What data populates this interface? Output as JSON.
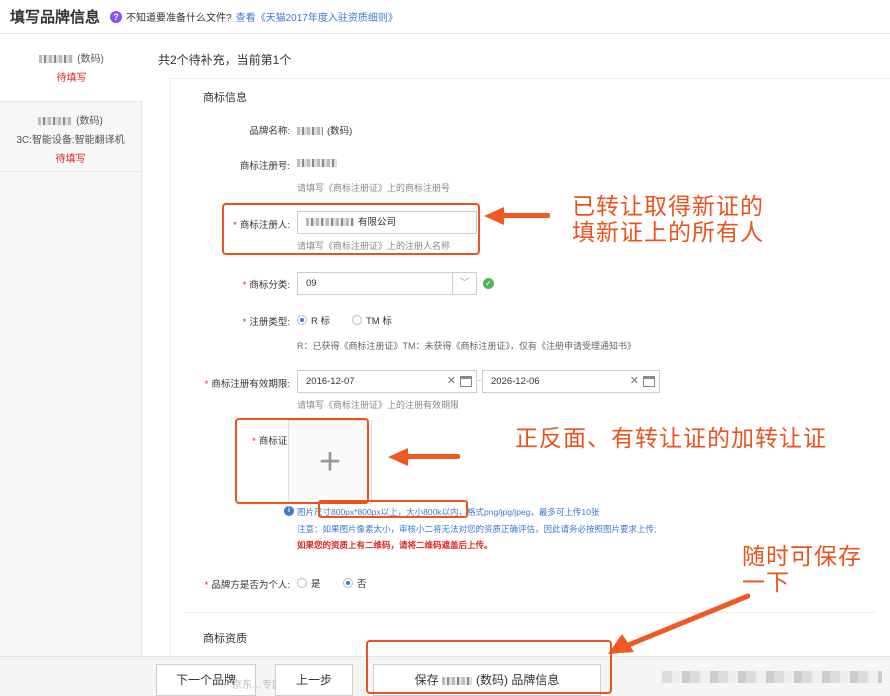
{
  "header": {
    "title": "填写品牌信息",
    "tip": "不知道要准备什么文件?",
    "link": "查看《天猫2017年度入驻资质细则》"
  },
  "sidebar": {
    "items": [
      {
        "cat": "",
        "name": "(数码)",
        "status": "待填写"
      },
      {
        "cat": "3C:智能设备:智能翻译机",
        "name": "(数码)",
        "status": "待填写"
      }
    ]
  },
  "progress": "共2个待补充，当前第1个",
  "section1": "商标信息",
  "form": {
    "brand_name_label": "品牌名称:",
    "brand_name_value": "(数码)",
    "reg_no_label": "商标注册号:",
    "reg_no_hint": "请填写《商标注册证》上的商标注册号",
    "registrant_label": "商标注册人:",
    "registrant_value": "有限公司",
    "registrant_hint": "请填写《商标注册证》上的注册人名称",
    "category_label": "商标分类:",
    "category_value": "09",
    "reg_type_label": "注册类型:",
    "reg_type_r": "R 标",
    "reg_type_tm": "TM 标",
    "reg_type_hint": "R：已获得《商标注册证》TM：未获得《商标注册证》，仅有《注册申请受理通知书》",
    "validity_label": "商标注册有效期限:",
    "validity_start": "2016-12-07",
    "validity_sep": "-",
    "validity_end": "2026-12-06",
    "validity_hint": "请填写《商标注册证》上的注册有效期限",
    "cert_label": "商标证:",
    "upload_hint_a": "图片尺寸800px*800px以上，大小800k以内，格式png/jpg/jpeg，最多可上传10张",
    "upload_hint_b": "注意：如果图片像素太小，审核小二将无法对您的资质正确评估，因此请务必按照图片要求上传;",
    "upload_hint_c": "如果您的资质上有二维码，请将二维码遮盖后上传。",
    "personal_label": "品牌方是否为个人:",
    "personal_yes": "是",
    "personal_no": "否"
  },
  "section2": "商标资质",
  "annotations": {
    "note1_l1": "已转让取得新证的",
    "note1_l2": "填新证上的所有人",
    "note2": "正反面、有转让证的加转让证",
    "note3_l1": "随时可保存",
    "note3_l2": "一下"
  },
  "footer": {
    "next_brand": "下一个品牌",
    "prev_step": "上一步",
    "save_label": "保存",
    "save_brand": "(数码)",
    "save_suffix": "品牌信息",
    "watermark": "京东…专区"
  },
  "colors": {
    "accent": "#3c78d8",
    "warning": "#e2231a",
    "annotation": "#e8541e"
  }
}
